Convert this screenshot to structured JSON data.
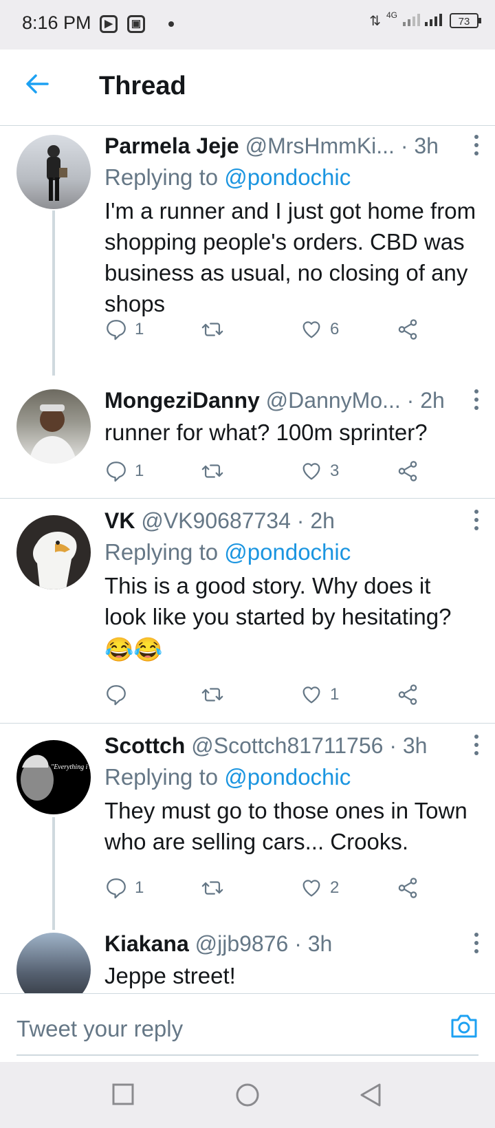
{
  "status": {
    "time": "8:16 PM",
    "network": "4G",
    "battery": "73"
  },
  "header": {
    "title": "Thread"
  },
  "tweets": [
    {
      "name": "Parmela Jeje",
      "handle": "@MrsHmmKi...",
      "time": "· 3h",
      "replying_label": "Replying to",
      "replying_handle": "@pondochic",
      "text": "I'm a runner and I just got home from shopping people's orders. CBD was business as usual, no closing of any shops",
      "replies": "1",
      "retweets": "",
      "likes": "6"
    },
    {
      "name": "MongeziDanny",
      "handle": "@DannyMo...",
      "time": "· 2h",
      "text": "runner for what? 100m sprinter?",
      "replies": "1",
      "retweets": "",
      "likes": "3"
    },
    {
      "name": "VK",
      "handle": "@VK90687734",
      "time": "· 2h",
      "replying_label": "Replying to",
      "replying_handle": "@pondochic",
      "text": "This is a good story. Why does it look like you started by hesitating?",
      "emoji": "😂😂",
      "replies": "",
      "retweets": "",
      "likes": "1"
    },
    {
      "name": "Scottch",
      "handle": "@Scottch81711756",
      "time": "· 3h",
      "replying_label": "Replying to",
      "replying_handle": "@pondochic",
      "text": "They must go to those ones in Town who are selling cars... Crooks.",
      "avatar_text": "\"Everything i Life is Vibra",
      "replies": "1",
      "retweets": "",
      "likes": "2"
    },
    {
      "name": "Kiakana",
      "handle": "@jjb9876",
      "time": "· 3h",
      "text": "Jeppe street!"
    }
  ],
  "composer": {
    "placeholder": "Tweet your reply"
  },
  "icons": {
    "back": "arrow-left-icon",
    "camera": "camera-icon",
    "reply": "reply-icon",
    "retweet": "retweet-icon",
    "like": "heart-icon",
    "share": "share-icon"
  },
  "colors": {
    "accent": "#1da1f2",
    "link": "#1b95e0",
    "muted": "#657786"
  }
}
